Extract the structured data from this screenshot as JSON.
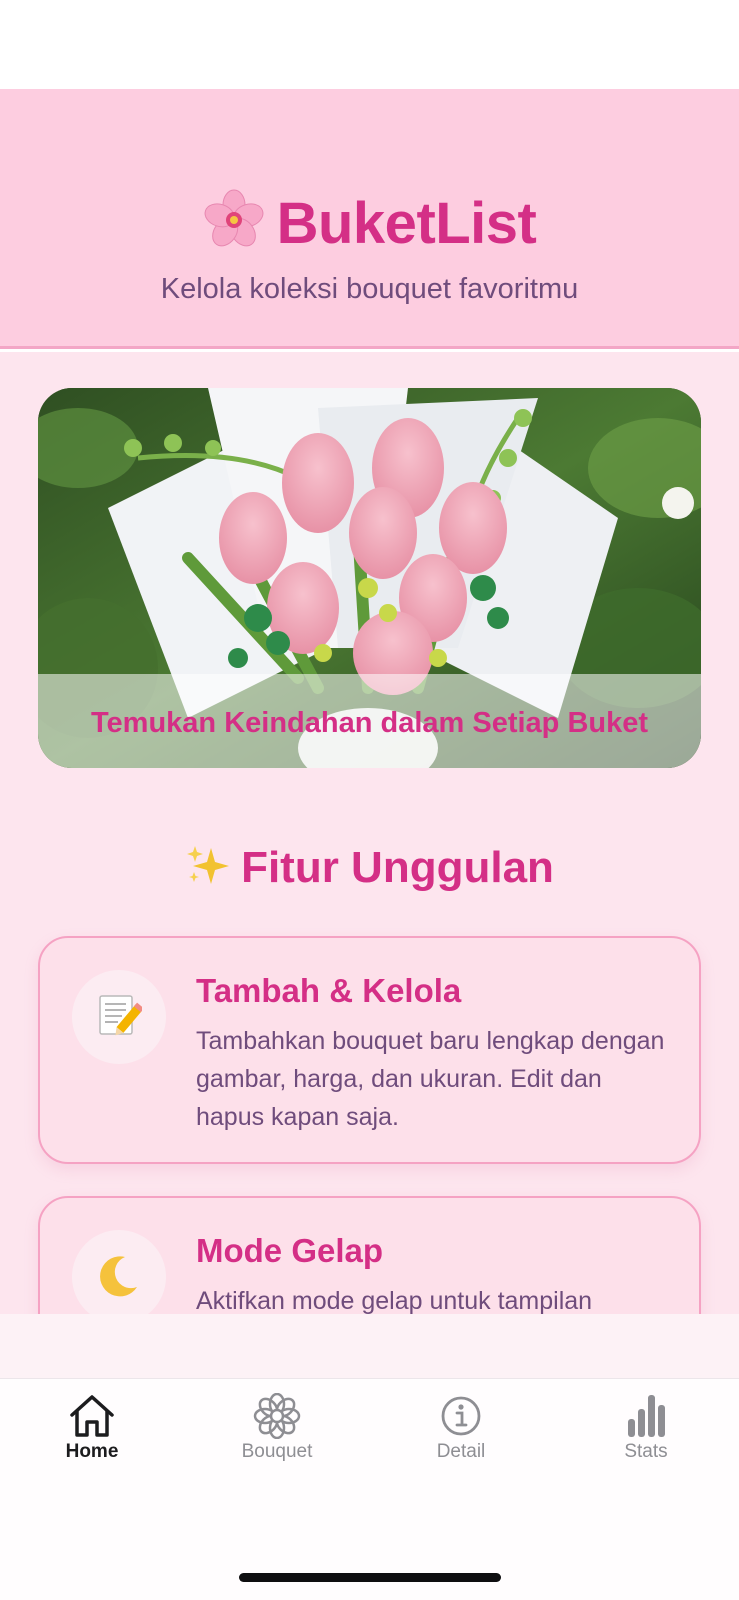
{
  "header": {
    "title": "BuketList",
    "subtitle": "Kelola koleksi bouquet favoritmu",
    "title_icon": "cherry-blossom-icon"
  },
  "hero": {
    "caption": "Temukan Keindahan dalam Setiap Buket",
    "image": "pink tulip pipe-cleaner bouquet wrapped in white paper"
  },
  "features": {
    "section_title": "Fitur Unggulan",
    "section_icon": "sparkles-icon",
    "items": [
      {
        "icon": "memo-pencil-icon",
        "title": "Tambah & Kelola",
        "description": "Tambahkan bouquet baru lengkap dengan gambar, harga, dan ukuran. Edit dan hapus kapan saja."
      },
      {
        "icon": "crescent-moon-icon",
        "title": "Mode Gelap",
        "description": "Aktifkan mode gelap untuk tampilan"
      }
    ]
  },
  "tabbar": {
    "tabs": [
      {
        "label": "Home",
        "icon": "house-icon",
        "active": true
      },
      {
        "label": "Bouquet",
        "icon": "flower-icon",
        "active": false
      },
      {
        "label": "Detail",
        "icon": "info-icon",
        "active": false
      },
      {
        "label": "Stats",
        "icon": "bar-chart-icon",
        "active": false
      }
    ]
  },
  "colors": {
    "accent": "#d42f86",
    "header_bg": "#fdcde0",
    "content_bg": "#fde5ee",
    "text_secondary": "#6f4c7c"
  }
}
